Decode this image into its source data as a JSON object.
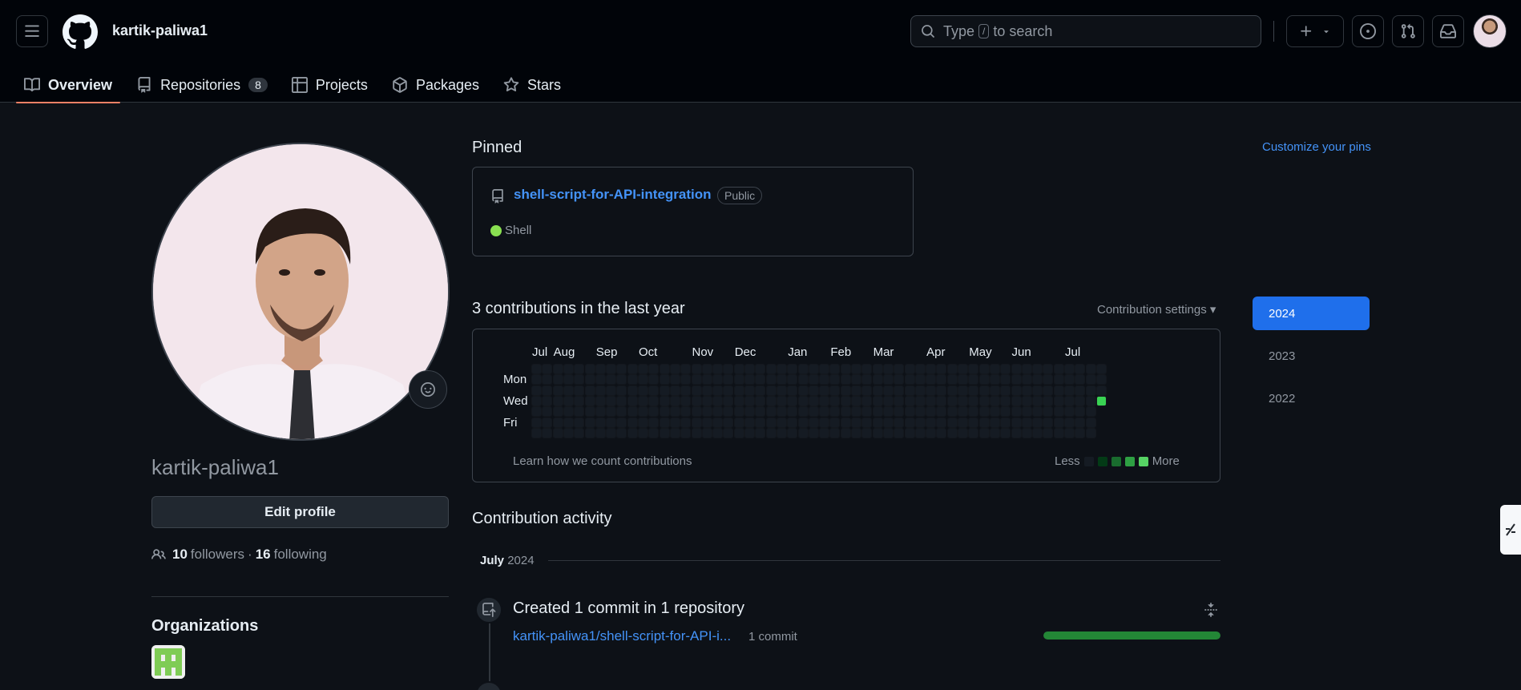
{
  "header": {
    "username": "kartik-paliwa1",
    "search": {
      "prefix": "Type",
      "key": "/",
      "suffix": "to search"
    }
  },
  "tabs": [
    {
      "label": "Overview",
      "icon": "book-icon",
      "active": true
    },
    {
      "label": "Repositories",
      "icon": "repo-icon",
      "count": "8"
    },
    {
      "label": "Projects",
      "icon": "table-icon"
    },
    {
      "label": "Packages",
      "icon": "package-icon"
    },
    {
      "label": "Stars",
      "icon": "star-icon"
    }
  ],
  "profile": {
    "username": "kartik-paliwa1",
    "edit_label": "Edit profile",
    "followers_count": "10",
    "followers_label": "followers",
    "separator": "·",
    "following_count": "16",
    "following_label": "following",
    "organizations_title": "Organizations"
  },
  "pinned": {
    "title": "Pinned",
    "customize_label": "Customize your pins",
    "repo": {
      "name": "shell-script-for-API-integration",
      "visibility": "Public",
      "language": "Shell",
      "language_color": "#89e051"
    }
  },
  "contributions": {
    "title": "3 contributions in the last year",
    "settings_label": "Contribution settings ▾",
    "months": [
      "Jul",
      "Aug",
      "Sep",
      "Oct",
      "Nov",
      "Dec",
      "Jan",
      "Feb",
      "Mar",
      "Apr",
      "May",
      "Jun",
      "Jul"
    ],
    "days": [
      "Mon",
      "Wed",
      "Fri"
    ],
    "learn_label": "Learn how we count contributions",
    "less_label": "Less",
    "more_label": "More",
    "legend_colors": [
      "#151b23",
      "#033a16",
      "#196c2e",
      "#2ea043",
      "#56d364"
    ],
    "active_cell": {
      "week": 53,
      "day": 3,
      "color": "#39d353"
    }
  },
  "years": [
    {
      "label": "2024",
      "active": true
    },
    {
      "label": "2023"
    },
    {
      "label": "2022"
    }
  ],
  "activity": {
    "title": "Contribution activity",
    "month": "July",
    "year": "2024",
    "summary": "Created 1 commit in 1 repository",
    "repo": "kartik-paliwa1/shell-script-for-API-i...",
    "commits": "1 commit",
    "progress": 1.0
  }
}
